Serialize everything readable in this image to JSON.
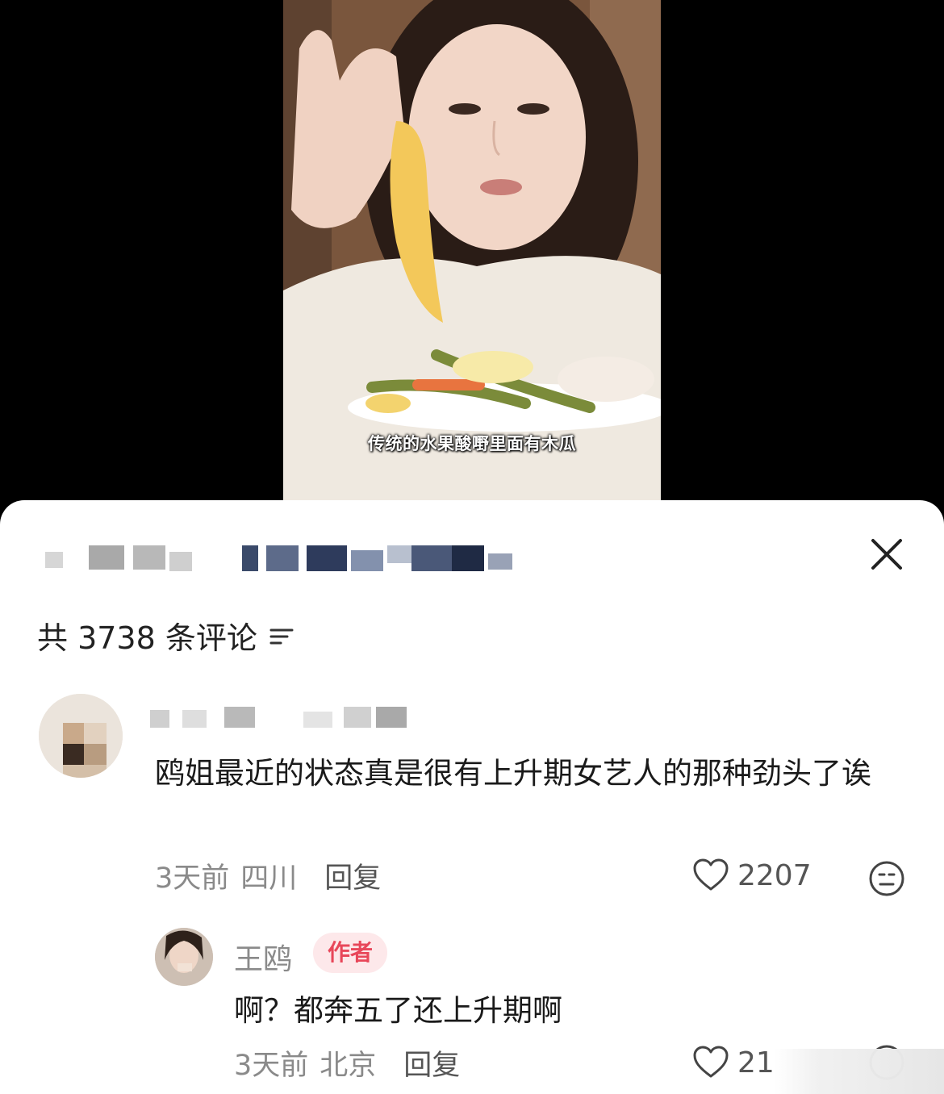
{
  "video": {
    "caption": "传统的水果酸嘢里面有木瓜"
  },
  "sheet": {
    "close_icon": "close-icon",
    "comment_count_label": "共 3738 条评论",
    "sort_icon": "sort-icon"
  },
  "comments": [
    {
      "text": "鸥姐最近的状态真是很有上升期女艺人的那种劲头了诶",
      "time": "3天前",
      "location": "四川",
      "reply_label": "回复",
      "likes": "2207"
    }
  ],
  "reply": {
    "author": "王鸥",
    "badge": "作者",
    "text": "啊？都奔五了还上升期啊",
    "time": "3天前",
    "location": "北京",
    "reply_label": "回复",
    "likes": "21"
  },
  "colors": {
    "badge_bg": "#fde8ea",
    "badge_text": "#e8475a",
    "meta_gray": "#8a8a8a"
  }
}
